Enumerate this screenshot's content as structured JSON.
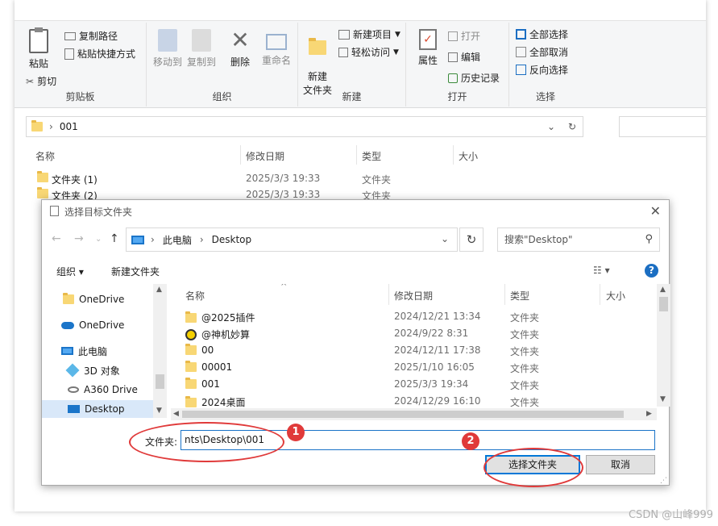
{
  "ribbon": {
    "clipboard": {
      "pin_label": "",
      "copy_path": "复制路径",
      "paste_shortcut": "粘贴快捷方式",
      "paste": "粘贴",
      "cut": "剪切",
      "group": "剪贴板"
    },
    "organize": {
      "move_to": "移动到",
      "copy_to": "复制到",
      "delete": "删除",
      "rename": "重命名",
      "group": "组织"
    },
    "new": {
      "new_folder": "新建\n文件夹",
      "new_item": "新建项目",
      "easy_access": "轻松访问",
      "group": "新建"
    },
    "open": {
      "properties": "属性",
      "open": "打开",
      "edit": "编辑",
      "history": "历史记录",
      "group": "打开"
    },
    "select": {
      "select_all": "全部选择",
      "select_none": "全部取消",
      "invert": "反向选择",
      "group": "选择"
    }
  },
  "explorer": {
    "address": "001",
    "columns": {
      "name": "名称",
      "date": "修改日期",
      "type": "类型",
      "size": "大小"
    },
    "rows": [
      {
        "name": "文件夹 (1)",
        "date": "2025/3/3 19:33",
        "type": "文件夹"
      },
      {
        "name": "文件夹 (2)",
        "date": "2025/3/3 19:33",
        "type": "文件夹"
      }
    ]
  },
  "dialog": {
    "title": "选择目标文件夹",
    "breadcrumb": [
      "此电脑",
      "Desktop"
    ],
    "search_placeholder": "搜索\"Desktop\"",
    "toolbar": {
      "organize": "组织 ▾",
      "new_folder": "新建文件夹"
    },
    "nav": [
      {
        "label": "OneDrive",
        "icon": "folder"
      },
      {
        "label": "OneDrive",
        "icon": "cloud"
      },
      {
        "label": "此电脑",
        "icon": "pc"
      },
      {
        "label": "3D 对象",
        "icon": "cube"
      },
      {
        "label": "A360 Drive",
        "icon": "drive"
      },
      {
        "label": "Desktop",
        "icon": "desktop"
      }
    ],
    "columns": {
      "name": "名称",
      "date": "修改日期",
      "type": "类型",
      "size": "大小"
    },
    "rows": [
      {
        "name": "@2025插件",
        "date": "2024/12/21 13:34",
        "type": "文件夹",
        "icon": "folder"
      },
      {
        "name": "@神机妙算",
        "date": "2024/9/22 8:31",
        "type": "文件夹",
        "icon": "special"
      },
      {
        "name": "00",
        "date": "2024/12/11 17:38",
        "type": "文件夹",
        "icon": "folder"
      },
      {
        "name": "00001",
        "date": "2025/1/10 16:05",
        "type": "文件夹",
        "icon": "folder"
      },
      {
        "name": "001",
        "date": "2025/3/3 19:34",
        "type": "文件夹",
        "icon": "folder"
      },
      {
        "name": "2024桌面",
        "date": "2024/12/29 16:10",
        "type": "文件夹",
        "icon": "folder"
      }
    ],
    "folder_label": "文件夹:",
    "folder_value": "nts\\Desktop\\001",
    "select_button": "选择文件夹",
    "cancel_button": "取消"
  },
  "annotations": {
    "badge1": "1",
    "badge2": "2",
    "color": "#e03a3a"
  },
  "watermark": "CSDN @山峰999"
}
